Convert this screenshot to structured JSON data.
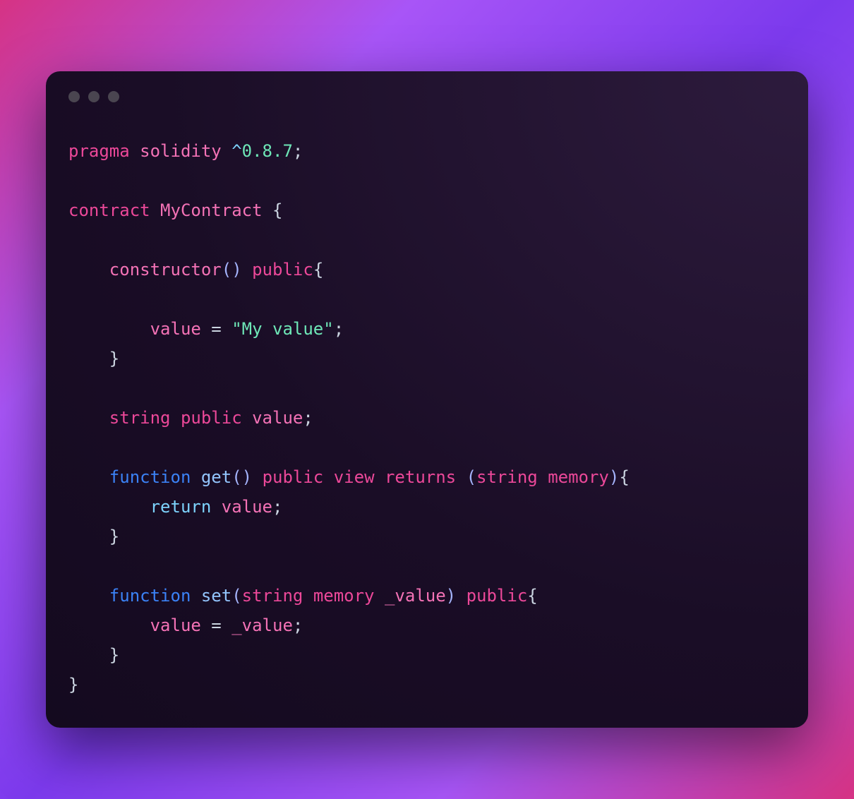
{
  "window": {
    "dots": 3
  },
  "code": {
    "tokens": [
      [
        {
          "t": "pragma",
          "c": "kw"
        },
        {
          "t": " ",
          "c": "plain"
        },
        {
          "t": "solidity",
          "c": "ident"
        },
        {
          "t": " ",
          "c": "plain"
        },
        {
          "t": "^",
          "c": "op"
        },
        {
          "t": "0.8.7",
          "c": "num"
        },
        {
          "t": ";",
          "c": "punc"
        }
      ],
      [],
      [
        {
          "t": "contract",
          "c": "kw"
        },
        {
          "t": " ",
          "c": "plain"
        },
        {
          "t": "MyContract",
          "c": "ident"
        },
        {
          "t": " {",
          "c": "punc"
        }
      ],
      [],
      [
        {
          "t": "    ",
          "c": "plain"
        },
        {
          "t": "constructor",
          "c": "ident"
        },
        {
          "t": "()",
          "c": "paren"
        },
        {
          "t": " ",
          "c": "plain"
        },
        {
          "t": "public",
          "c": "kw"
        },
        {
          "t": "{",
          "c": "punc"
        }
      ],
      [],
      [
        {
          "t": "        ",
          "c": "plain"
        },
        {
          "t": "value",
          "c": "ident"
        },
        {
          "t": " ",
          "c": "plain"
        },
        {
          "t": "=",
          "c": "punc"
        },
        {
          "t": " ",
          "c": "plain"
        },
        {
          "t": "\"My value\"",
          "c": "str"
        },
        {
          "t": ";",
          "c": "punc"
        }
      ],
      [
        {
          "t": "    }",
          "c": "punc"
        }
      ],
      [],
      [
        {
          "t": "    ",
          "c": "plain"
        },
        {
          "t": "string",
          "c": "type"
        },
        {
          "t": " ",
          "c": "plain"
        },
        {
          "t": "public",
          "c": "kw"
        },
        {
          "t": " ",
          "c": "plain"
        },
        {
          "t": "value",
          "c": "ident"
        },
        {
          "t": ";",
          "c": "punc"
        }
      ],
      [],
      [
        {
          "t": "    ",
          "c": "plain"
        },
        {
          "t": "function",
          "c": "kw2"
        },
        {
          "t": " ",
          "c": "plain"
        },
        {
          "t": "get",
          "c": "fn"
        },
        {
          "t": "()",
          "c": "paren"
        },
        {
          "t": " ",
          "c": "plain"
        },
        {
          "t": "public",
          "c": "kw"
        },
        {
          "t": " ",
          "c": "plain"
        },
        {
          "t": "view",
          "c": "kw"
        },
        {
          "t": " ",
          "c": "plain"
        },
        {
          "t": "returns",
          "c": "kw"
        },
        {
          "t": " ",
          "c": "plain"
        },
        {
          "t": "(",
          "c": "paren"
        },
        {
          "t": "string",
          "c": "type"
        },
        {
          "t": " ",
          "c": "plain"
        },
        {
          "t": "memory",
          "c": "mem"
        },
        {
          "t": ")",
          "c": "paren"
        },
        {
          "t": "{",
          "c": "punc"
        }
      ],
      [
        {
          "t": "        ",
          "c": "plain"
        },
        {
          "t": "return",
          "c": "ret"
        },
        {
          "t": " ",
          "c": "plain"
        },
        {
          "t": "value",
          "c": "ident"
        },
        {
          "t": ";",
          "c": "punc"
        }
      ],
      [
        {
          "t": "    }",
          "c": "punc"
        }
      ],
      [],
      [
        {
          "t": "    ",
          "c": "plain"
        },
        {
          "t": "function",
          "c": "kw2"
        },
        {
          "t": " ",
          "c": "plain"
        },
        {
          "t": "set",
          "c": "fn"
        },
        {
          "t": "(",
          "c": "paren"
        },
        {
          "t": "string",
          "c": "type"
        },
        {
          "t": " ",
          "c": "plain"
        },
        {
          "t": "memory",
          "c": "mem"
        },
        {
          "t": " ",
          "c": "plain"
        },
        {
          "t": "_value",
          "c": "ident"
        },
        {
          "t": ")",
          "c": "paren"
        },
        {
          "t": " ",
          "c": "plain"
        },
        {
          "t": "public",
          "c": "kw"
        },
        {
          "t": "{",
          "c": "punc"
        }
      ],
      [
        {
          "t": "        ",
          "c": "plain"
        },
        {
          "t": "value",
          "c": "ident"
        },
        {
          "t": " ",
          "c": "plain"
        },
        {
          "t": "=",
          "c": "punc"
        },
        {
          "t": " ",
          "c": "plain"
        },
        {
          "t": "_value",
          "c": "ident"
        },
        {
          "t": ";",
          "c": "punc"
        }
      ],
      [
        {
          "t": "    }",
          "c": "punc"
        }
      ],
      [
        {
          "t": "}",
          "c": "punc"
        }
      ]
    ]
  }
}
